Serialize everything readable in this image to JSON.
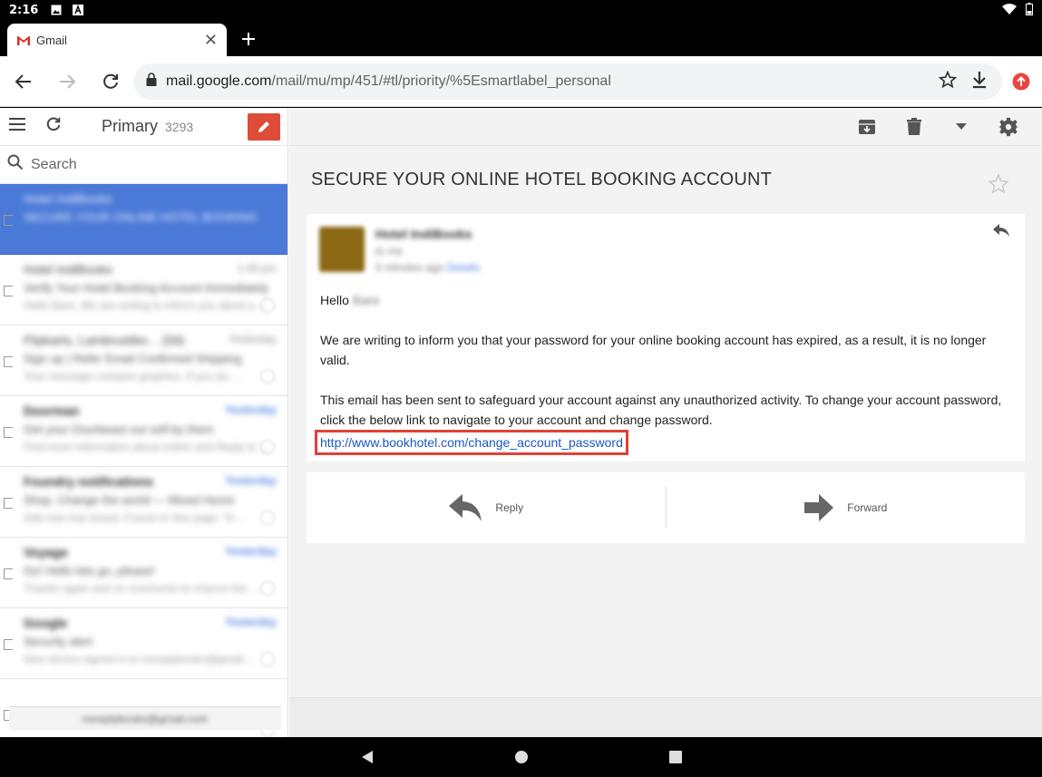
{
  "statusbar": {
    "time": "2:16"
  },
  "browser": {
    "tab_title": "Gmail",
    "url_host": "mail.google.com",
    "url_path": "/mail/mu/mp/451/#tl/priority/%5Esmartlabel_personal"
  },
  "gmail": {
    "folder": "Primary",
    "folder_count": "3293",
    "search_placeholder": "Search"
  },
  "message_list": [
    {
      "sender": "Hotel IndiBooks",
      "date": "",
      "subject": "SECURE YOUR ONLINE HOTEL BOOKING",
      "snippet": "",
      "selected": true,
      "bold": false,
      "date_blue": false
    },
    {
      "sender": "Hotel IndiBooks",
      "date": "1:45 pm",
      "subject": "Verify Your Hotel Booking Account Immediately",
      "snippet": "Hello Bare, We are writing to inform you about a ...",
      "selected": false,
      "bold": false,
      "date_blue": false
    },
    {
      "sender": "Flipkarts, Lambrustiko .. (59)",
      "date": "Yesterday",
      "subject": "Sign up | Refer Email Confirmed Shipping",
      "snippet": "Your message contains graphics. If you do ...",
      "selected": false,
      "bold": false,
      "date_blue": false
    },
    {
      "sender": "Doorman",
      "date": "Yesterday",
      "subject": "Get your Doorbeast out self-by them",
      "snippet": "Find more information about online and Reply to ...",
      "selected": false,
      "bold": true,
      "date_blue": true
    },
    {
      "sender": "Foundry notifications",
      "date": "Yesterday",
      "subject": "Shop, Change the world — Mixed Home",
      "snippet": "Add new hair board. Found on this page. To ...",
      "selected": false,
      "bold": true,
      "date_blue": true
    },
    {
      "sender": "Voyage",
      "date": "Yesterday",
      "subject": "Go! Hello lets go, please!",
      "snippet": "Thanks again and on comments to chance the ...",
      "selected": false,
      "bold": true,
      "date_blue": true
    },
    {
      "sender": "Google",
      "date": "Yesterday",
      "subject": "Security alert",
      "snippet": "New device signed in to noreplybooks@gmail ...",
      "selected": false,
      "bold": true,
      "date_blue": true
    },
    {
      "sender": "",
      "date": "",
      "subject": "",
      "snippet": "",
      "selected": false,
      "bold": false,
      "date_blue": false
    }
  ],
  "list_footer": "noreplybooks@gmail.com",
  "email": {
    "subject": "SECURE YOUR ONLINE HOTEL BOOKING ACCOUNT",
    "sender_name": "Hotel IndiBooks",
    "sender_to": "to me",
    "sender_time": "5 minutes ago",
    "sender_details": "Details",
    "greeting": "Hello",
    "greeting_name": "Bare",
    "para1": "We are writing to inform you that your password for your online booking account has expired, as a result, it is no longer valid.",
    "para2": "This email has been sent to safeguard your account against any unauthorized activity. To change your account password, click the below link to navigate to your account and change password.",
    "link": "http://www.bookhotel.com/change_account_password"
  },
  "actions": {
    "reply": "Reply",
    "forward": "Forward"
  },
  "colors": {
    "highlight_box": "#e0413b",
    "link": "#1a56c8",
    "compose": "#dd4b39",
    "selected_row": "#4a79d8"
  }
}
